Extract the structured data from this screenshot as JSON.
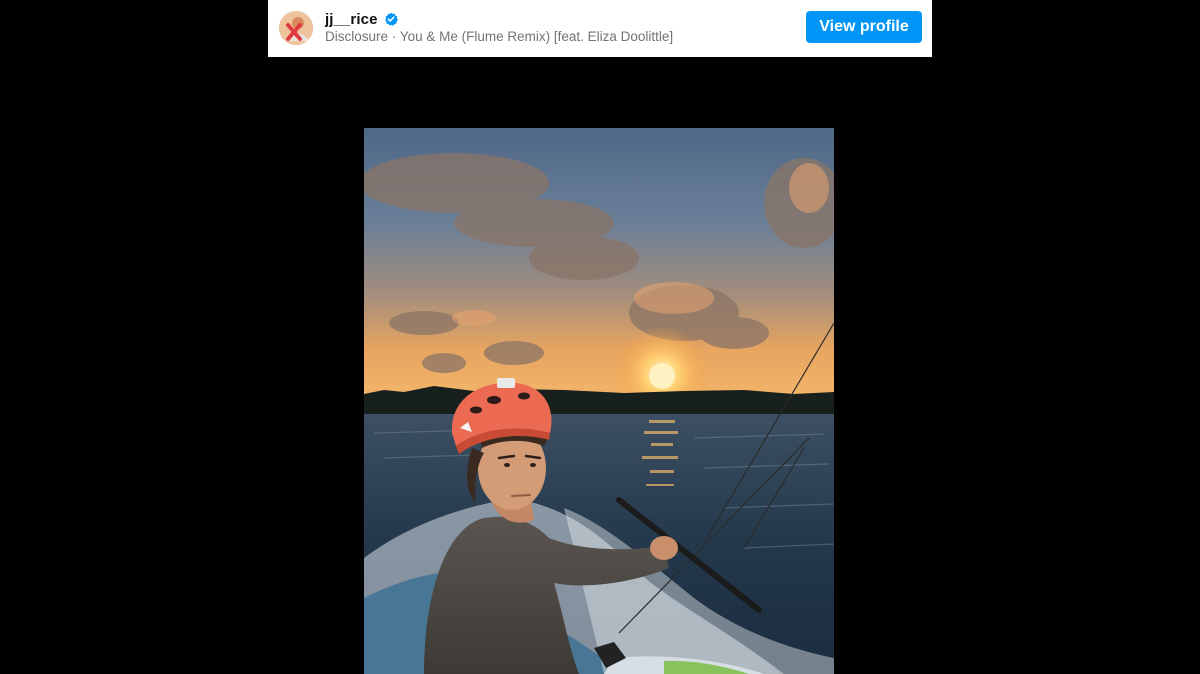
{
  "post_header": {
    "username": "jj__rice",
    "verified": true,
    "verified_icon": "verified-badge-icon",
    "artist": "Disclosure",
    "separator": "·",
    "song": "You & Me (Flume Remix) [feat. Eliza Doolittle]",
    "view_profile_label": "View profile",
    "accent_color": "#0095f6"
  },
  "media": {
    "kind": "video-still",
    "scene": "sunset-kiteboarding"
  }
}
